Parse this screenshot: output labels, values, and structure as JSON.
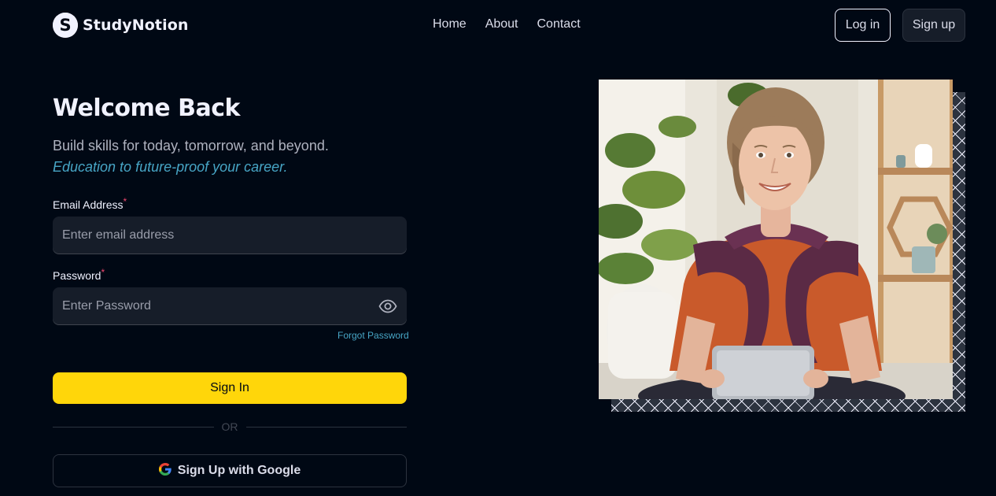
{
  "brand": {
    "name": "StudyNotion",
    "logo_letter": "S"
  },
  "nav": {
    "links": [
      "Home",
      "About",
      "Contact"
    ],
    "login_label": "Log in",
    "signup_label": "Sign up"
  },
  "form": {
    "title": "Welcome Back",
    "subtitle": "Build skills for today, tomorrow, and beyond.",
    "tagline": "Education to future-proof your career.",
    "email_label": "Email Address",
    "email_placeholder": "Enter email address",
    "password_label": "Password",
    "password_placeholder": "Enter Password",
    "required_mark": "*",
    "forgot_label": "Forgot Password",
    "signin_label": "Sign In",
    "or_label": "OR",
    "google_label": "Sign Up with Google"
  },
  "colors": {
    "background": "#000814",
    "accent_yellow": "#FFD60A",
    "link_blue": "#47A5C5",
    "input_bg": "#161D29",
    "required_red": "#EF476F"
  },
  "icons": {
    "brand": "studynotion-logo-icon",
    "password_toggle": "eye-icon",
    "google": "google-icon"
  }
}
